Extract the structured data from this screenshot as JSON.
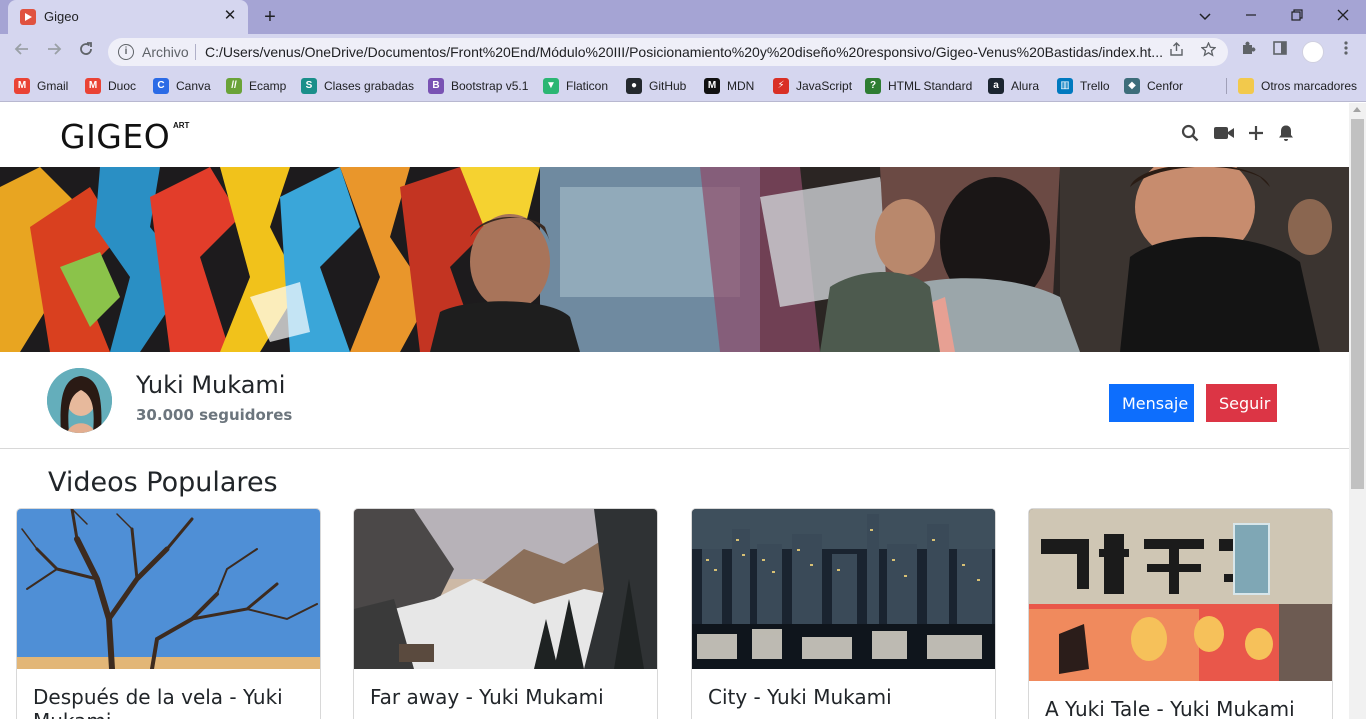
{
  "browser": {
    "tab_title": "Gigeo",
    "close_glyph": "✕",
    "new_tab_glyph": "+",
    "scheme_label": "Archivo",
    "url": "C:/Users/venus/OneDrive/Documentos/Front%20End/Módulo%20III/Posicionamiento%20y%20diseño%20responsivo/Gigeo-Venus%20Bastidas/index.ht...",
    "bookmarks": [
      {
        "label": "Gmail",
        "color": "#ea4335",
        "glyph": "M"
      },
      {
        "label": "Duoc",
        "color": "#ea4335",
        "glyph": "M"
      },
      {
        "label": "Canva",
        "color": "#2b6be6",
        "glyph": "C"
      },
      {
        "label": "Ecamp",
        "color": "#6aa338",
        "glyph": "//"
      },
      {
        "label": "Clases grabadas",
        "color": "#1a8f8a",
        "glyph": "S"
      },
      {
        "label": "Bootstrap v5.1",
        "color": "#7952b3",
        "glyph": "B"
      },
      {
        "label": "Flaticon",
        "color": "#2bb673",
        "glyph": "▼"
      },
      {
        "label": "GitHub",
        "color": "#24292e",
        "glyph": "●"
      },
      {
        "label": "MDN",
        "color": "#111111",
        "glyph": "M"
      },
      {
        "label": "JavaScript",
        "color": "#d93025",
        "glyph": "⚡"
      },
      {
        "label": "HTML Standard",
        "color": "#2e7d32",
        "glyph": "?"
      },
      {
        "label": "Alura",
        "color": "#1b2530",
        "glyph": "a"
      },
      {
        "label": "Trello",
        "color": "#0079bf",
        "glyph": "▥"
      },
      {
        "label": "Cenfor",
        "color": "#3d6d7a",
        "glyph": "◆"
      }
    ],
    "other_bookmarks": "Otros marcadores"
  },
  "site": {
    "logo": "GIGEO",
    "logo_sup": "ART"
  },
  "profile": {
    "name": "Yuki Mukami",
    "followers": "30.000 seguidores",
    "message_button": "Mensaje",
    "follow_button": "Seguir"
  },
  "videos": {
    "section_title": "Videos Populares",
    "items": [
      {
        "title": "Después de la vela - Yuki Mukami",
        "thumbnail": "desert-dead-tree-blue-sky"
      },
      {
        "title": "Far away - Yuki Mukami",
        "thumbnail": "snowy-mountain-valley-sunset"
      },
      {
        "title": "City - Yuki Mukami",
        "thumbnail": "night-city-skyline"
      },
      {
        "title": "A Yuki Tale - Yuki Mukami",
        "thumbnail": "japanese-shop-sign-lanterns"
      }
    ]
  },
  "colors": {
    "primary": "#0d6efd",
    "danger": "#dc3545",
    "chrome_tabbar": "#a5a4d4",
    "chrome_toolbar": "#d5d6ef"
  }
}
